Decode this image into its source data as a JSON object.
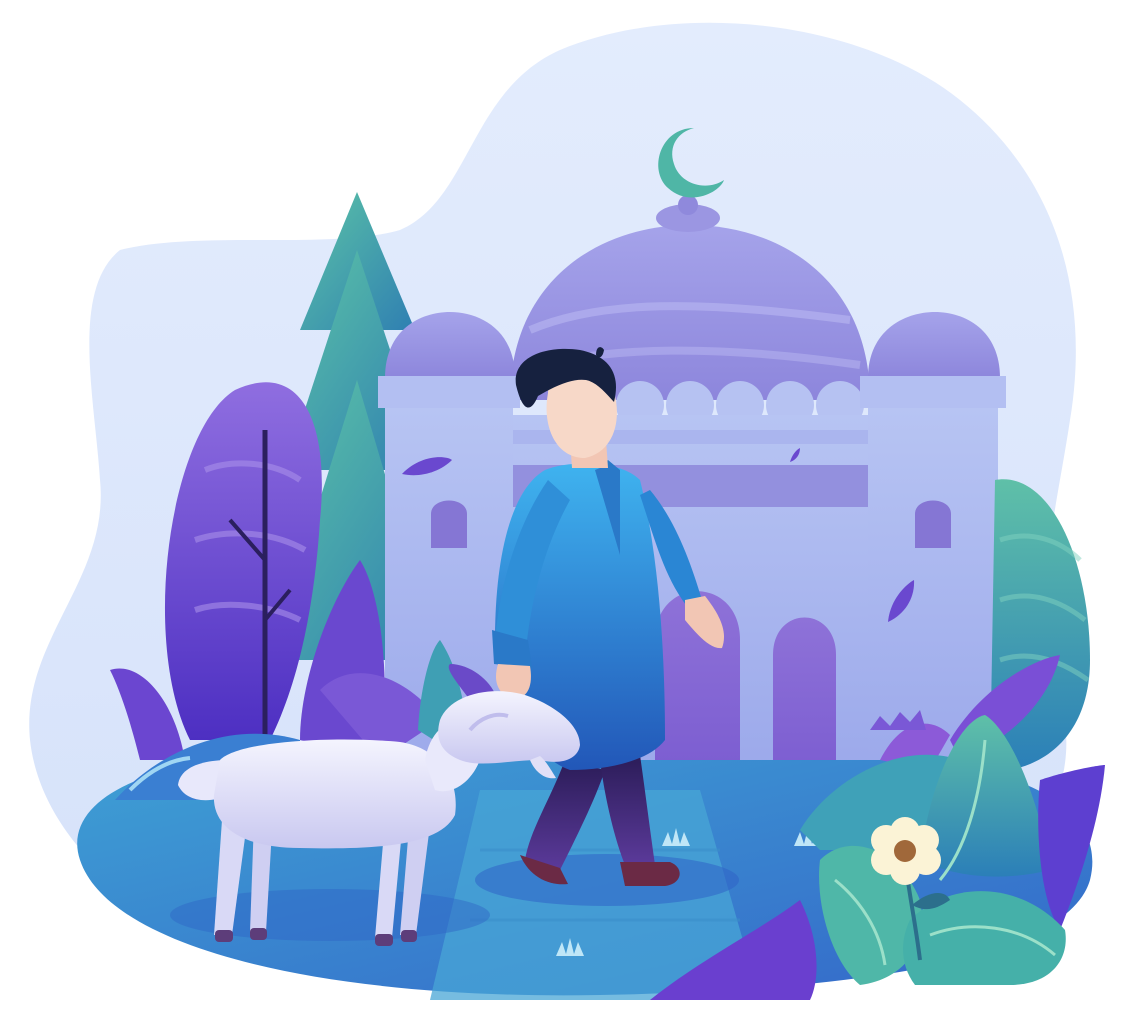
{
  "scene": {
    "elements": [
      "background-blob",
      "cypress-tree",
      "mosque",
      "crescent-moon",
      "boy",
      "goat",
      "flower",
      "foliage"
    ]
  },
  "colors": {
    "sky_blob": "#dbe6fb",
    "mosque_wall": "#a9b6ee",
    "mosque_dome": "#9f9de6",
    "mosque_dark": "#8c7fd8",
    "crescent": "#4fb6a6",
    "tree": "#3fa6a2",
    "leaf_purple": "#6a48cf",
    "leaf_teal": "#3a9fb0",
    "ground": "#3a8fd4",
    "path": "#46a9d8",
    "kurta": "#2f8ed8",
    "trousers": "#3b2773",
    "skin": "#f7d8c8",
    "hair": "#16213f",
    "goat": "#e7e8fb",
    "flower_petal": "#fbf3d6",
    "flower_center": "#a0683a"
  }
}
